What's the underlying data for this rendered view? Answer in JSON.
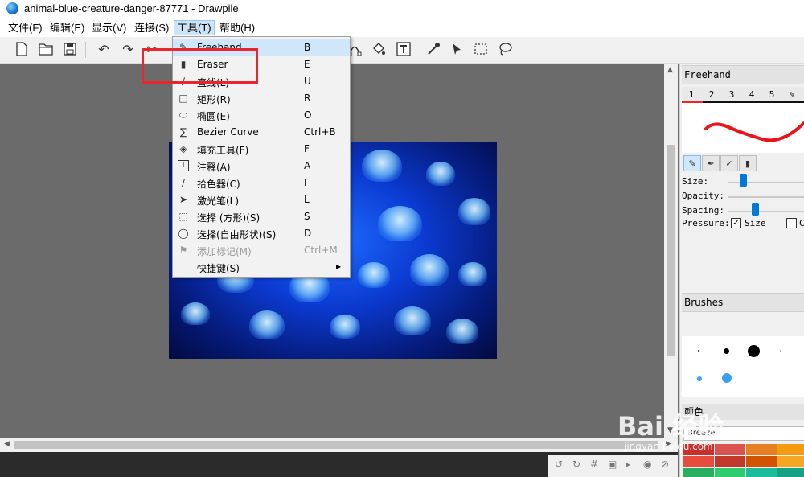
{
  "window": {
    "title": "animal-blue-creature-danger-87771 - Drawpile"
  },
  "menubar": [
    {
      "label": "文件(F)"
    },
    {
      "label": "编辑(E)"
    },
    {
      "label": "显示(V)"
    },
    {
      "label": "连接(S)"
    },
    {
      "label": "工具(T)"
    },
    {
      "label": "帮助(H)"
    }
  ],
  "toolbar_icons": [
    "new-file",
    "open-folder",
    "save",
    "undo",
    "redo",
    "cut",
    "copy"
  ],
  "tools_menu": {
    "items": [
      {
        "label": "Freehand",
        "shortcut": "B",
        "icon": "freehand-icon"
      },
      {
        "label": "Eraser",
        "shortcut": "E",
        "icon": "eraser-icon"
      },
      {
        "label": "直线(L)",
        "shortcut": "U",
        "icon": "line-icon"
      },
      {
        "label": "矩形(R)",
        "shortcut": "R",
        "icon": "rectangle-icon"
      },
      {
        "label": "椭圆(E)",
        "shortcut": "O",
        "icon": "ellipse-icon"
      },
      {
        "label": "Bezier Curve",
        "shortcut": "Ctrl+B",
        "icon": "bezier-icon"
      },
      {
        "label": "填充工具(F)",
        "shortcut": "F",
        "icon": "fill-icon"
      },
      {
        "label": "注释(A)",
        "shortcut": "A",
        "icon": "annotation-icon"
      },
      {
        "label": "拾色器(C)",
        "shortcut": "I",
        "icon": "color-picker-icon"
      },
      {
        "label": "激光笔(L)",
        "shortcut": "L",
        "icon": "laser-pointer-icon"
      },
      {
        "label": "选择 (方形)(S)",
        "shortcut": "S",
        "icon": "rect-select-icon"
      },
      {
        "label": "选择(自由形状)(S)",
        "shortcut": "D",
        "icon": "lasso-select-icon"
      },
      {
        "label": "添加标记(M)",
        "shortcut": "Ctrl+M",
        "icon": "flag-icon",
        "disabled": true
      },
      {
        "label": "快捷键(S)",
        "shortcut": "",
        "icon": "",
        "submenu": true
      }
    ]
  },
  "panel": {
    "tool_title": "Freehand",
    "slots": [
      "1",
      "2",
      "3",
      "4",
      "5"
    ],
    "size_label": "Size:",
    "opacity_label": "Opacity:",
    "spacing_label": "Spacing:",
    "pressure_label": "Pressure:",
    "pressure_size_label": "Size",
    "pressure_c_label": "C",
    "brushes_title": "Brushes",
    "palette_title": "颜色",
    "palette_selected": "Breeze"
  },
  "watermark": {
    "text": "Bai 经验",
    "sub": "jingyan.baidu.com"
  },
  "colors": {
    "accent": "#0078d7",
    "highlight_box": "#e8262c"
  }
}
